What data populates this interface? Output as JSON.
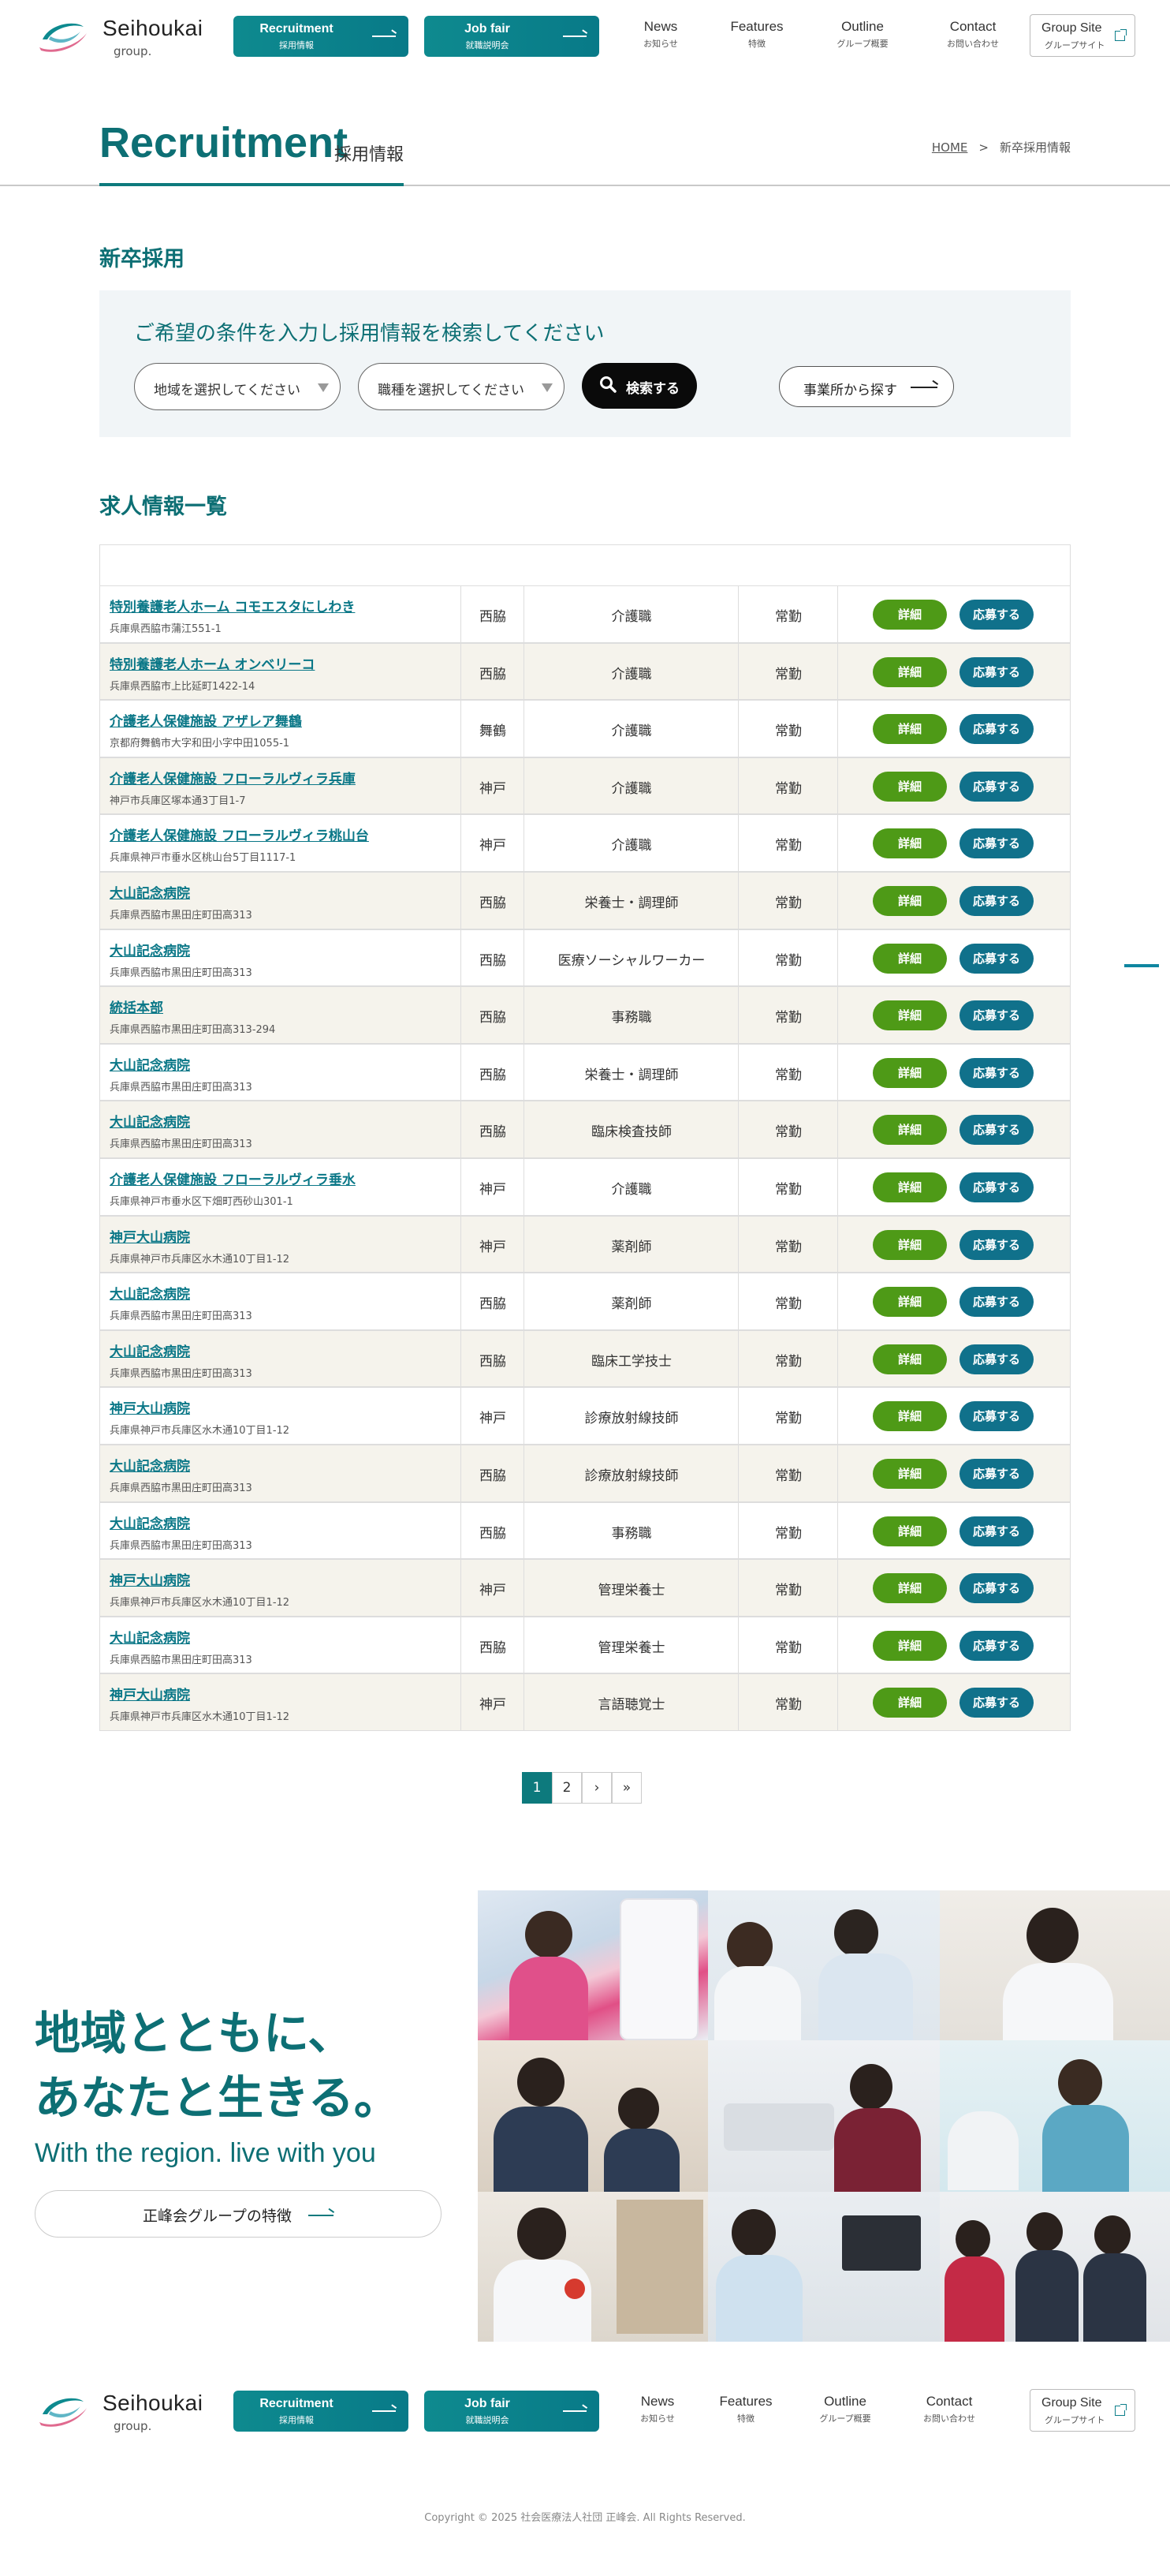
{
  "header": {
    "logo_text": "Seihoukai",
    "logo_sub": "group.",
    "recruit_en": "Recruitment",
    "recruit_ja": "採用情報",
    "jobfair_en": "Job fair",
    "jobfair_ja": "就職説明会",
    "nav": [
      {
        "en": "News",
        "ja": "お知らせ"
      },
      {
        "en": "Features",
        "ja": "特徴"
      },
      {
        "en": "Outline",
        "ja": "グループ概要"
      },
      {
        "en": "Contact",
        "ja": "お問い合わせ"
      }
    ],
    "group_en": "Group Site",
    "group_ja": "グループサイト"
  },
  "page": {
    "title_en": "Recruitment",
    "title_ja": "採用情報",
    "breadcrumb_home": "HOME",
    "breadcrumb_sep": ">",
    "breadcrumb_current": "新卒採用情報"
  },
  "section_new_grad": "新卒採用",
  "search": {
    "title": "ご希望の条件を入力し採用情報を検索してください",
    "area_placeholder": "地域を選択してください",
    "job_placeholder": "職種を選択してください",
    "search_label": "検索する",
    "office_label": "事業所から探す"
  },
  "section_list": "求人情報一覧",
  "jobs": [
    {
      "name": "特別養護老人ホーム コモエスタにしわき",
      "addr": "兵庫県西脇市蒲江551-1",
      "area": "西脇",
      "job": "介護職",
      "type": "常勤"
    },
    {
      "name": "特別養護老人ホーム オンベリーコ",
      "addr": "兵庫県西脇市上比延町1422-14",
      "area": "西脇",
      "job": "介護職",
      "type": "常勤"
    },
    {
      "name": "介護老人保健施設 アザレア舞鶴",
      "addr": "京都府舞鶴市大字和田小字中田1055-1",
      "area": "舞鶴",
      "job": "介護職",
      "type": "常勤"
    },
    {
      "name": "介護老人保健施設 フローラルヴィラ兵庫",
      "addr": "神戸市兵庫区塚本通3丁目1-7",
      "area": "神戸",
      "job": "介護職",
      "type": "常勤"
    },
    {
      "name": "介護老人保健施設 フローラルヴィラ桃山台",
      "addr": "兵庫県神戸市垂水区桃山台5丁目1117-1",
      "area": "神戸",
      "job": "介護職",
      "type": "常勤"
    },
    {
      "name": "大山記念病院",
      "addr": "兵庫県西脇市黒田庄町田高313",
      "area": "西脇",
      "job": "栄養士・調理師",
      "type": "常勤"
    },
    {
      "name": "大山記念病院",
      "addr": "兵庫県西脇市黒田庄町田高313",
      "area": "西脇",
      "job": "医療ソーシャルワーカー",
      "type": "常勤"
    },
    {
      "name": "統括本部",
      "addr": "兵庫県西脇市黒田庄町田高313-294",
      "area": "西脇",
      "job": "事務職",
      "type": "常勤"
    },
    {
      "name": "大山記念病院",
      "addr": "兵庫県西脇市黒田庄町田高313",
      "area": "西脇",
      "job": "栄養士・調理師",
      "type": "常勤"
    },
    {
      "name": "大山記念病院",
      "addr": "兵庫県西脇市黒田庄町田高313",
      "area": "西脇",
      "job": "臨床検査技師",
      "type": "常勤"
    },
    {
      "name": "介護老人保健施設 フローラルヴィラ垂水",
      "addr": "兵庫県神戸市垂水区下畑町西砂山301-1",
      "area": "神戸",
      "job": "介護職",
      "type": "常勤"
    },
    {
      "name": "神戸大山病院",
      "addr": "兵庫県神戸市兵庫区水木通10丁目1-12",
      "area": "神戸",
      "job": "薬剤師",
      "type": "常勤"
    },
    {
      "name": "大山記念病院",
      "addr": "兵庫県西脇市黒田庄町田高313",
      "area": "西脇",
      "job": "薬剤師",
      "type": "常勤"
    },
    {
      "name": "大山記念病院",
      "addr": "兵庫県西脇市黒田庄町田高313",
      "area": "西脇",
      "job": "臨床工学技士",
      "type": "常勤"
    },
    {
      "name": "神戸大山病院",
      "addr": "兵庫県神戸市兵庫区水木通10丁目1-12",
      "area": "神戸",
      "job": "診療放射線技師",
      "type": "常勤"
    },
    {
      "name": "大山記念病院",
      "addr": "兵庫県西脇市黒田庄町田高313",
      "area": "西脇",
      "job": "診療放射線技師",
      "type": "常勤"
    },
    {
      "name": "大山記念病院",
      "addr": "兵庫県西脇市黒田庄町田高313",
      "area": "西脇",
      "job": "事務職",
      "type": "常勤"
    },
    {
      "name": "神戸大山病院",
      "addr": "兵庫県神戸市兵庫区水木通10丁目1-12",
      "area": "神戸",
      "job": "管理栄養士",
      "type": "常勤"
    },
    {
      "name": "大山記念病院",
      "addr": "兵庫県西脇市黒田庄町田高313",
      "area": "西脇",
      "job": "管理栄養士",
      "type": "常勤"
    },
    {
      "name": "神戸大山病院",
      "addr": "兵庫県神戸市兵庫区水木通10丁目1-12",
      "area": "神戸",
      "job": "言語聴覚士",
      "type": "常勤"
    }
  ],
  "row_buttons": {
    "detail": "詳細",
    "apply": "応募する"
  },
  "pager": {
    "pages": [
      "1",
      "2"
    ],
    "next": "›",
    "last": "»",
    "current": "1"
  },
  "hero": {
    "line1": "地域とともに、",
    "line2": "あなたと生きる。",
    "en": "With the region. live with you",
    "button": "正峰会グループの特徴"
  },
  "footer": {
    "copyright": "Copyright © 2025 社会医療法人社団 正峰会. All Rights Reserved."
  },
  "colors": {
    "brand": "#0d7a7d",
    "detail": "#4e9a17",
    "apply": "#10718b"
  }
}
